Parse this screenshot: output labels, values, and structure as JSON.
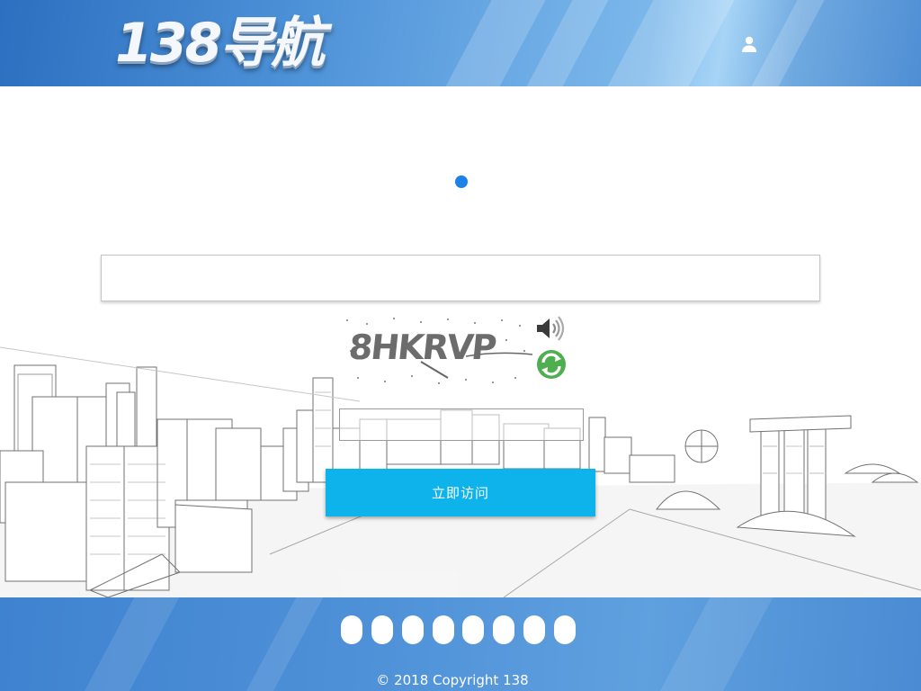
{
  "header": {
    "logo_text": "138导航",
    "user_icon": "user-icon"
  },
  "main": {
    "loading_indicator_color": "#1a82e8",
    "url_input": {
      "value": "",
      "placeholder": ""
    },
    "captcha": {
      "text": "8HKRVP",
      "audio_icon": "speaker-icon",
      "refresh_icon": "refresh-icon"
    },
    "captcha_input": {
      "value": "",
      "placeholder": ""
    },
    "submit_label": "立即访问"
  },
  "footer": {
    "pill_count": 8,
    "copyright": "© 2018 Copyright 138"
  },
  "colors": {
    "header_blue": "#4a8fd6",
    "button_cyan": "#0db3ea",
    "footer_blue": "#4f91d8"
  }
}
